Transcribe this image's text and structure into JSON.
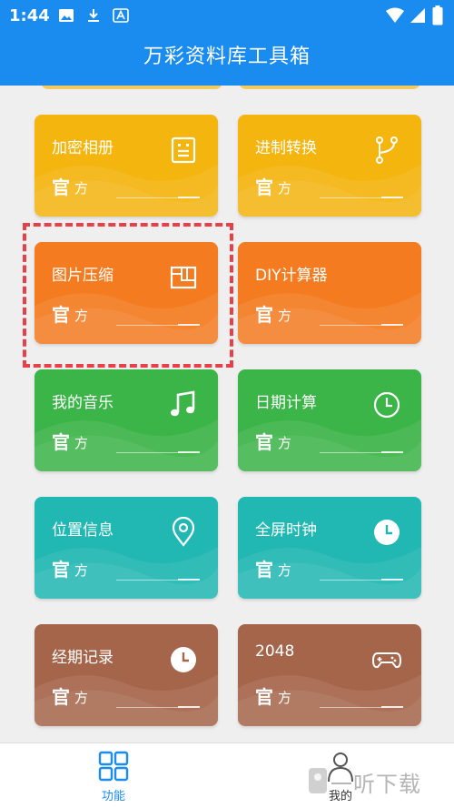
{
  "status_bar": {
    "time": "1:44",
    "icons": [
      "image-icon",
      "download-icon",
      "app-a-icon",
      "wifi-icon",
      "signal-icon",
      "battery-icon"
    ]
  },
  "header": {
    "title": "万彩资料库工具箱"
  },
  "colors": {
    "primary": "#1a8cf0",
    "yellow": "#f5b50f",
    "orange": "#f47b20",
    "green": "#3bb448",
    "teal": "#21b7b2",
    "brown": "#a5654a",
    "selection": "#e84049"
  },
  "cards": [
    {
      "name": "加密相册",
      "badge_main": "官",
      "badge_sub": "方",
      "icon": "album-icon",
      "color": "#f5b50f"
    },
    {
      "name": "进制转换",
      "badge_main": "官",
      "badge_sub": "方",
      "icon": "branch-icon",
      "color": "#f5b50f"
    },
    {
      "name": "图片压缩",
      "badge_main": "官",
      "badge_sub": "方",
      "icon": "compress-icon",
      "color": "#f47b20"
    },
    {
      "name": "DIY计算器",
      "badge_main": "官",
      "badge_sub": "方",
      "icon": "",
      "color": "#f47b20"
    },
    {
      "name": "我的音乐",
      "badge_main": "官",
      "badge_sub": "方",
      "icon": "music-icon",
      "color": "#3bb448"
    },
    {
      "name": "日期计算",
      "badge_main": "官",
      "badge_sub": "方",
      "icon": "clock-icon",
      "color": "#3bb448"
    },
    {
      "name": "位置信息",
      "badge_main": "官",
      "badge_sub": "方",
      "icon": "location-icon",
      "color": "#21b7b2"
    },
    {
      "name": "全屏时钟",
      "badge_main": "官",
      "badge_sub": "方",
      "icon": "clock-icon",
      "color": "#21b7b2"
    },
    {
      "name": "经期记录",
      "badge_main": "官",
      "badge_sub": "方",
      "icon": "clock-icon",
      "color": "#a5654a"
    },
    {
      "name": "2048",
      "badge_main": "官",
      "badge_sub": "方",
      "icon": "gamepad-icon",
      "color": "#a5654a"
    }
  ],
  "bottom_nav": [
    {
      "label": "功能",
      "icon": "grid-icon",
      "active": true,
      "color": "#1a8cf0"
    },
    {
      "label": "我的",
      "icon": "person-icon",
      "active": false,
      "color": "#333333"
    }
  ],
  "watermark": {
    "text": "一听下载"
  }
}
